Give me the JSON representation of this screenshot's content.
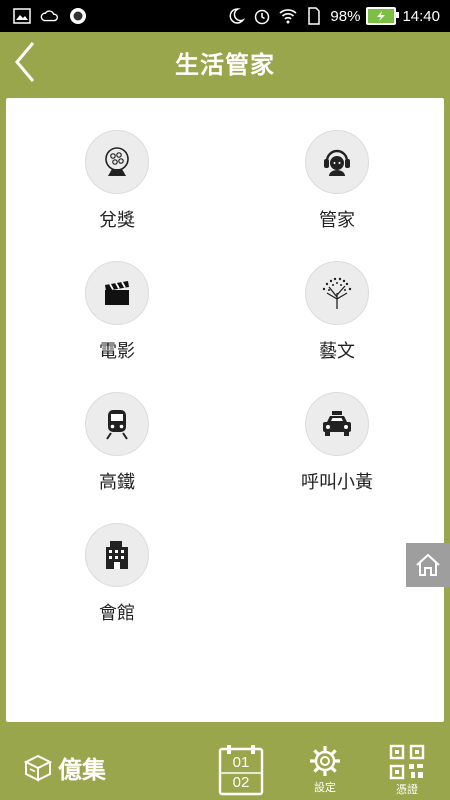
{
  "status_bar": {
    "battery": "98%",
    "time": "14:40",
    "icons": [
      "image-icon",
      "cloud-icon",
      "record-icon",
      "moon-icon",
      "alarm-icon",
      "wifi-icon",
      "sim-icon",
      "battery-icon"
    ]
  },
  "header": {
    "title": "生活管家",
    "back_icon": "chevron-left-icon"
  },
  "menu": {
    "items": [
      {
        "label": "兌獎",
        "icon": "lottery-icon"
      },
      {
        "label": "管家",
        "icon": "headset-icon"
      },
      {
        "label": "電影",
        "icon": "clapperboard-icon"
      },
      {
        "label": "藝文",
        "icon": "tree-icon"
      },
      {
        "label": "高鐵",
        "icon": "train-icon"
      },
      {
        "label": "呼叫小黃",
        "icon": "taxi-icon"
      },
      {
        "label": "會館",
        "icon": "building-icon"
      }
    ]
  },
  "floating": {
    "icon": "home-icon"
  },
  "bottom_bar": {
    "brand": "億集",
    "calendar_top": "01",
    "calendar_bottom": "02",
    "settings_label": "設定",
    "qr_label": "憑證"
  },
  "colors": {
    "accent": "#9aa64b",
    "panel": "#ffffff",
    "fab": "#9e9e9e"
  }
}
